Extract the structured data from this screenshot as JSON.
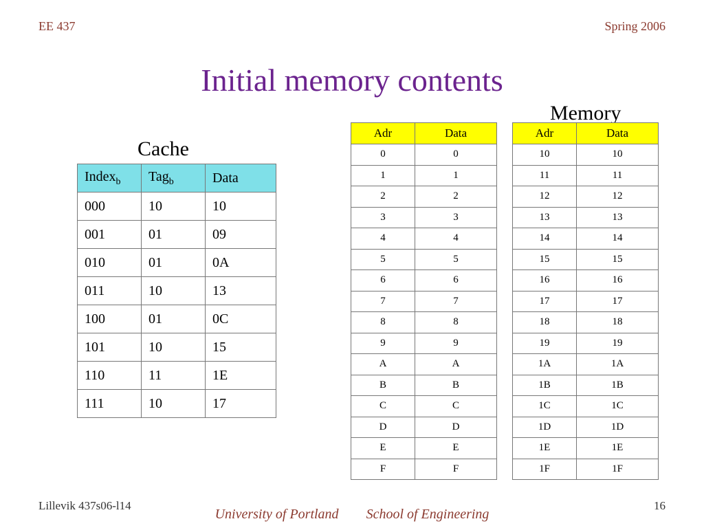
{
  "header": {
    "left": "EE 437",
    "right": "Spring 2006"
  },
  "title": "Initial memory contents",
  "labels": {
    "cache": "Cache",
    "memory": "Memory"
  },
  "cache": {
    "headers": {
      "index_prefix": "Index",
      "index_sub": "b",
      "tag_prefix": "Tag",
      "tag_sub": "b",
      "data": "Data"
    },
    "rows": [
      {
        "index": "000",
        "tag": "10",
        "data": "10"
      },
      {
        "index": "001",
        "tag": "01",
        "data": "09"
      },
      {
        "index": "010",
        "tag": "01",
        "data": "0A"
      },
      {
        "index": "011",
        "tag": "10",
        "data": "13"
      },
      {
        "index": "100",
        "tag": "01",
        "data": "0C"
      },
      {
        "index": "101",
        "tag": "10",
        "data": "15"
      },
      {
        "index": "110",
        "tag": "11",
        "data": "1E"
      },
      {
        "index": "111",
        "tag": "10",
        "data": "17"
      }
    ]
  },
  "memory": {
    "headers": {
      "adr": "Adr",
      "data": "Data"
    },
    "table1": [
      {
        "adr": "0",
        "data": "0"
      },
      {
        "adr": "1",
        "data": "1"
      },
      {
        "adr": "2",
        "data": "2"
      },
      {
        "adr": "3",
        "data": "3"
      },
      {
        "adr": "4",
        "data": "4"
      },
      {
        "adr": "5",
        "data": "5"
      },
      {
        "adr": "6",
        "data": "6"
      },
      {
        "adr": "7",
        "data": "7"
      },
      {
        "adr": "8",
        "data": "8"
      },
      {
        "adr": "9",
        "data": "9"
      },
      {
        "adr": "A",
        "data": "A"
      },
      {
        "adr": "B",
        "data": "B"
      },
      {
        "adr": "C",
        "data": "C"
      },
      {
        "adr": "D",
        "data": "D"
      },
      {
        "adr": "E",
        "data": "E"
      },
      {
        "adr": "F",
        "data": "F"
      }
    ],
    "table2": [
      {
        "adr": "10",
        "data": "10"
      },
      {
        "adr": "11",
        "data": "11"
      },
      {
        "adr": "12",
        "data": "12"
      },
      {
        "adr": "13",
        "data": "13"
      },
      {
        "adr": "14",
        "data": "14"
      },
      {
        "adr": "15",
        "data": "15"
      },
      {
        "adr": "16",
        "data": "16"
      },
      {
        "adr": "17",
        "data": "17"
      },
      {
        "adr": "18",
        "data": "18"
      },
      {
        "adr": "19",
        "data": "19"
      },
      {
        "adr": "1A",
        "data": "1A"
      },
      {
        "adr": "1B",
        "data": "1B"
      },
      {
        "adr": "1C",
        "data": "1C"
      },
      {
        "adr": "1D",
        "data": "1D"
      },
      {
        "adr": "1E",
        "data": "1E"
      },
      {
        "adr": "1F",
        "data": "1F"
      }
    ]
  },
  "footer": {
    "left": "Lillevik    437s06-l14",
    "page": "16",
    "uop_left": "University of Portland",
    "uop_right": "School of Engineering"
  }
}
